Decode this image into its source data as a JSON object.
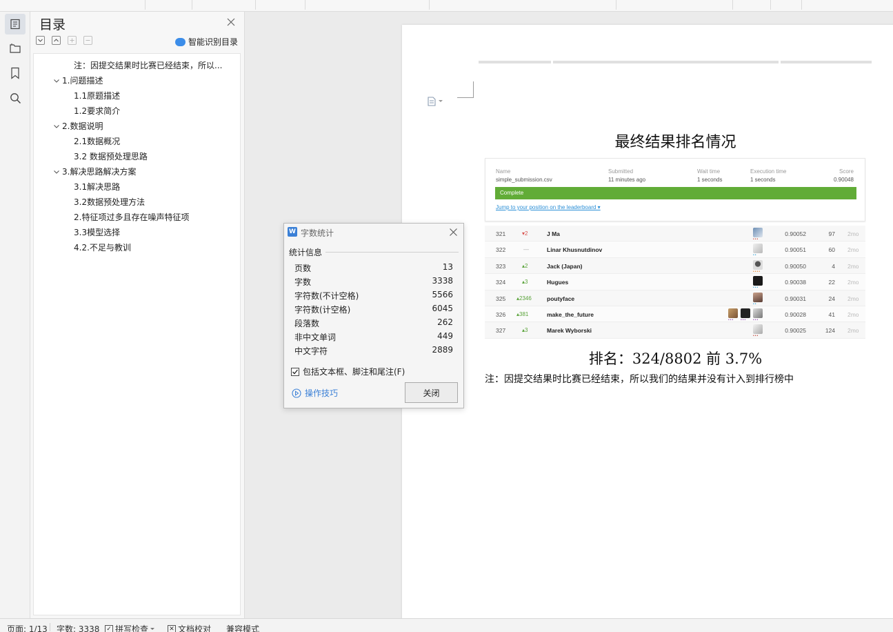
{
  "toc": {
    "title": "目录",
    "smart_label": "智能识别目录",
    "items": [
      {
        "label": "注：因提交结果时比赛已经结束，所以..."
      },
      {
        "label": "1.问题描述"
      },
      {
        "label": "1.1原题描述"
      },
      {
        "label": "1.2要求简介"
      },
      {
        "label": "2.数据说明"
      },
      {
        "label": "2.1数据概况"
      },
      {
        "label": "3.2 数据预处理思路"
      },
      {
        "label": "3.解决思路解决方案"
      },
      {
        "label": "3.1解决思路"
      },
      {
        "label": "3.2数据预处理方法"
      },
      {
        "label": "2.特征项过多且存在噪声特征项"
      },
      {
        "label": "3.3模型选择"
      },
      {
        "label": "4.2.不足与教训"
      }
    ]
  },
  "document": {
    "heading": "最终结果排名情况",
    "rank_text": "排名：324/8802  前 3.7%",
    "note_text": "注：因提交结果时比赛已经结束，所以我们的结果并没有计入到排行榜中",
    "submission": {
      "headers": [
        "Name",
        "Submitted",
        "Wait time",
        "Execution time",
        "Score"
      ],
      "values": [
        "simple_submission.csv",
        "11 minutes ago",
        "1 seconds",
        "1 seconds",
        "0.90048"
      ],
      "status": "Complete",
      "jump_link": "Jump to your position on the leaderboard ▾"
    },
    "leaderboard": [
      {
        "rank": "321",
        "change": "▾2",
        "dir": "down",
        "name": "J Ma",
        "score": "0.90052",
        "entries": "97",
        "last": "2mo"
      },
      {
        "rank": "322",
        "change": "—",
        "dir": "flat",
        "name": "Linar Khusnutdinov",
        "score": "0.90051",
        "entries": "60",
        "last": "2mo"
      },
      {
        "rank": "323",
        "change": "▴2",
        "dir": "up",
        "name": "Jack (Japan)",
        "score": "0.90050",
        "entries": "4",
        "last": "2mo"
      },
      {
        "rank": "324",
        "change": "▴3",
        "dir": "up",
        "name": "Hugues",
        "score": "0.90038",
        "entries": "22",
        "last": "2mo"
      },
      {
        "rank": "325",
        "change": "▴2346",
        "dir": "up",
        "name": "poutyface",
        "score": "0.90031",
        "entries": "24",
        "last": "2mo"
      },
      {
        "rank": "326",
        "change": "▴381",
        "dir": "up",
        "name": "make_the_future",
        "score": "0.90028",
        "entries": "41",
        "last": "2mo"
      },
      {
        "rank": "327",
        "change": "▴3",
        "dir": "up",
        "name": "Marek Wyborski",
        "score": "0.90025",
        "entries": "124",
        "last": "2mo"
      }
    ]
  },
  "dialog": {
    "title": "字数统计",
    "section": "统计信息",
    "stats": [
      {
        "label": "页数",
        "value": "13"
      },
      {
        "label": "字数",
        "value": "3338"
      },
      {
        "label": "字符数(不计空格)",
        "value": "5566"
      },
      {
        "label": "字符数(计空格)",
        "value": "6045"
      },
      {
        "label": "段落数",
        "value": "262"
      },
      {
        "label": "非中文单词",
        "value": "449"
      },
      {
        "label": "中文字符",
        "value": "2889"
      }
    ],
    "checkbox_label": "包括文本框、脚注和尾注(F)",
    "checkbox_checked": true,
    "tips_label": "操作技巧",
    "close_label": "关闭"
  },
  "statusbar": {
    "page": "页面: 1/13",
    "words": "字数: 3338",
    "spell": "拼写检查",
    "proof": "文档校对",
    "compat": "兼容模式"
  },
  "colors": {
    "accent": "#3b80d6",
    "complete_bar": "#61ac37",
    "rank_up": "#5aa33a",
    "rank_down": "#d9534f"
  }
}
